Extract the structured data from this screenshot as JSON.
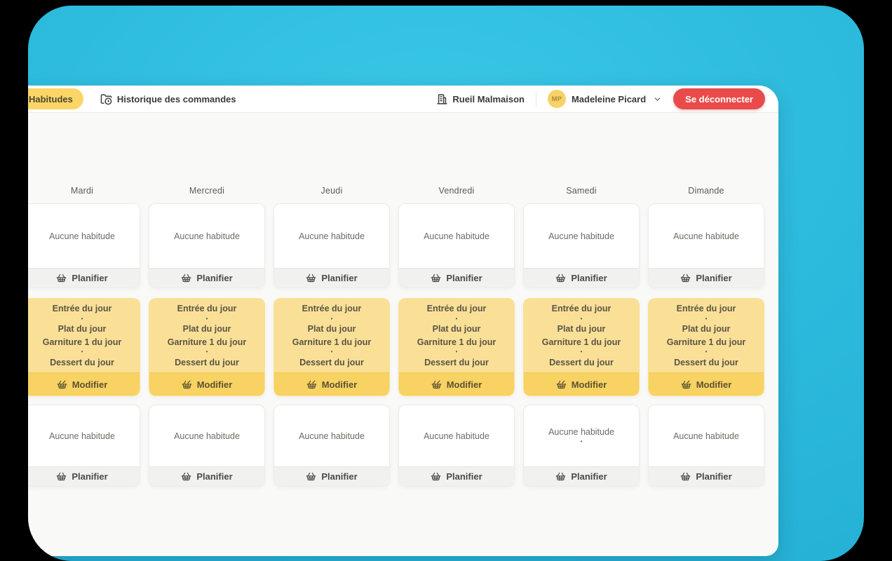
{
  "topbar": {
    "habits_tab": "Habitudes",
    "history_tab": "Historique des commandes",
    "history_icon": "folder-clock-icon",
    "location": "Rueil Malmaison",
    "location_icon": "building-icon",
    "user_initials": "MP",
    "user_name": "Madeleine Picard",
    "user_menu_icon": "chevron-down-icon",
    "logout_label": "Se déconnecter"
  },
  "planner": {
    "days": [
      "Mardi",
      "Mercredi",
      "Jeudi",
      "Vendredi",
      "Samedi",
      "Dimande"
    ],
    "rows": [
      {
        "kind": "empty",
        "action": "Planifier",
        "action_icon": "basket-icon",
        "cells": [
          [
            "Aucune habitude"
          ],
          [
            "Aucune habitude"
          ],
          [
            "Aucune habitude"
          ],
          [
            "Aucune habitude"
          ],
          [
            "Aucune habitude"
          ],
          [
            "Aucune habitude"
          ]
        ]
      },
      {
        "kind": "habit",
        "action": "Modifier",
        "action_icon": "basket-edit-icon",
        "cells": [
          [
            "Entrée du jour",
            "•",
            "Plat du jour",
            "Garniture 1 du jour",
            "•",
            "Dessert du jour"
          ],
          [
            "Entrée du jour",
            "•",
            "Plat du jour",
            "Garniture 1 du jour",
            "•",
            "Dessert du jour"
          ],
          [
            "Entrée du jour",
            "•",
            "Plat du jour",
            "Garniture 1 du jour",
            "•",
            "Dessert du jour"
          ],
          [
            "Entrée du jour",
            "•",
            "Plat du jour",
            "Garniture 1 du jour",
            "•",
            "Dessert du jour"
          ],
          [
            "Entrée du jour",
            "•",
            "Plat du jour",
            "Garniture 1 du jour",
            "•",
            "Dessert du jour"
          ],
          [
            "Entrée du jour",
            "•",
            "Plat du jour",
            "Garniture 1 du jour",
            "•",
            "Dessert du jour"
          ]
        ]
      },
      {
        "kind": "empty",
        "action": "Planifier",
        "action_icon": "basket-icon",
        "cells": [
          [
            "Aucune habitude"
          ],
          [
            "Aucune habitude"
          ],
          [
            "Aucune habitude"
          ],
          [
            "Aucune habitude"
          ],
          [
            "Aucune habitude",
            "•"
          ],
          [
            "Aucune habitude"
          ]
        ]
      }
    ]
  },
  "colors": {
    "cyan": "#2bb9dc",
    "cyan_light": "#3ac7e6",
    "cyan_dark": "#22aed3",
    "accent_yellow": "#fbd667",
    "avatar_yellow": "#f6d268",
    "card_yellow": "#fae097",
    "card_yellow_footer": "#f8d262",
    "logout_red": "#e94b4b"
  }
}
